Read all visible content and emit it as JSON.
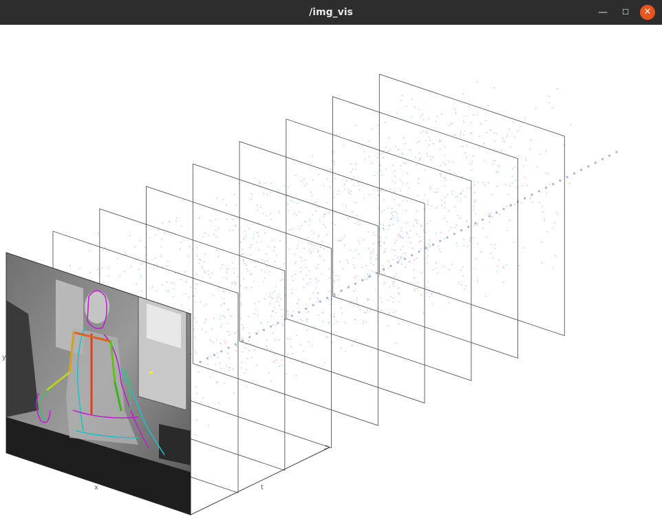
{
  "window": {
    "title": "/img_vis",
    "minimize_glyph": "—",
    "maximize_glyph": "☐",
    "close_glyph": "✕",
    "close_color": "#e95420"
  },
  "plot": {
    "axis_x_label": "x",
    "axis_y_label": "y",
    "axis_t_label": "t",
    "frame_count": 9,
    "event_colors": [
      "#c060d0",
      "#40c0c0",
      "#8080c0"
    ],
    "skeleton_colors": [
      "#e04020",
      "#60c020",
      "#c0c020",
      "#e08020"
    ]
  }
}
